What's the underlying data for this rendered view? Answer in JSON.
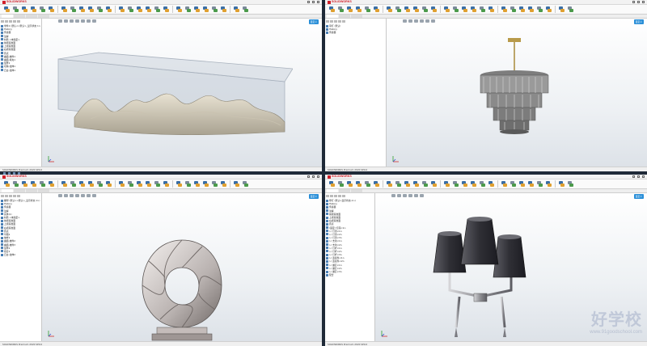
{
  "app": {
    "logo_text": "SOLIDWORKS",
    "colors": {
      "brand": "#d1202a",
      "accent": "#2a8fd8",
      "taskbar": "#1f2a38"
    }
  },
  "panes": [
    {
      "id": "terrain",
      "model": "wavy-terrain-in-transparent-box",
      "tree": [
        "零件1 (默认<<默认>_显示状态 1>)",
        "History",
        "传感器",
        "注解",
        "材质 <未指定>",
        "前视基准面",
        "上视基准面",
        "右视基准面",
        "原点",
        "曲面-放样1",
        "曲面-填充1",
        "加厚1",
        "切除-拉伸1",
        "凸台-拉伸1"
      ],
      "status": "SOLIDWORKS Premium 2020 SP0.0",
      "badge": "自定义"
    },
    {
      "id": "chandelier",
      "model": "crystal-chandelier",
      "tree": [
        "吊灯 (默认)",
        "History",
        "传感器"
      ],
      "status": "SOLIDWORKS Premium 2020 SP0.0",
      "badge": "自定义"
    },
    {
      "id": "sculpture",
      "model": "spiral-ring-sculpture",
      "tree": [
        "雕塑 (默认<<默认>_显示状态 1>)",
        "History",
        "传感器",
        "注解",
        "实体(1)",
        "材质 <未指定>",
        "前视基准面",
        "上视基准面",
        "右视基准面",
        "原点",
        "草图1",
        "放样1",
        "曲面-放样2",
        "曲面-放样3",
        "加厚2",
        "组合1",
        "凸台-拉伸2"
      ],
      "status": "SOLIDWORKS Premium 2020 SP0.0",
      "badge": "自定义"
    },
    {
      "id": "wall-lamp",
      "model": "three-shade-wall-lamp",
      "tree": [
        "壁灯 (默认<显示状态-1>)",
        "History",
        "传感器",
        "注解",
        "前视基准面",
        "上视基准面",
        "右视基准面",
        "原点",
        "(固定) 灯座<1>",
        "(-) 灯罩<1>",
        "(-) 灯罩<2>",
        "(-) 灯罩<3>",
        "(-) 支架<1>",
        "(-) 支架<2>",
        "(-) 灯杆<1>",
        "(-) 灯杆<2>",
        "(-) 灯杆<3>",
        "(-) 连接件<1>",
        "(-) 连接件<2>",
        "(-) 螺钉<1>",
        "(-) 螺钉<2>",
        "(-) 螺钉<3>",
        "配合"
      ],
      "status": "SOLIDWORKS Premium 2020 SP0.0",
      "badge": "自定义"
    }
  ],
  "watermark": {
    "main": "好学校",
    "url": "www.91goodschool.com"
  }
}
